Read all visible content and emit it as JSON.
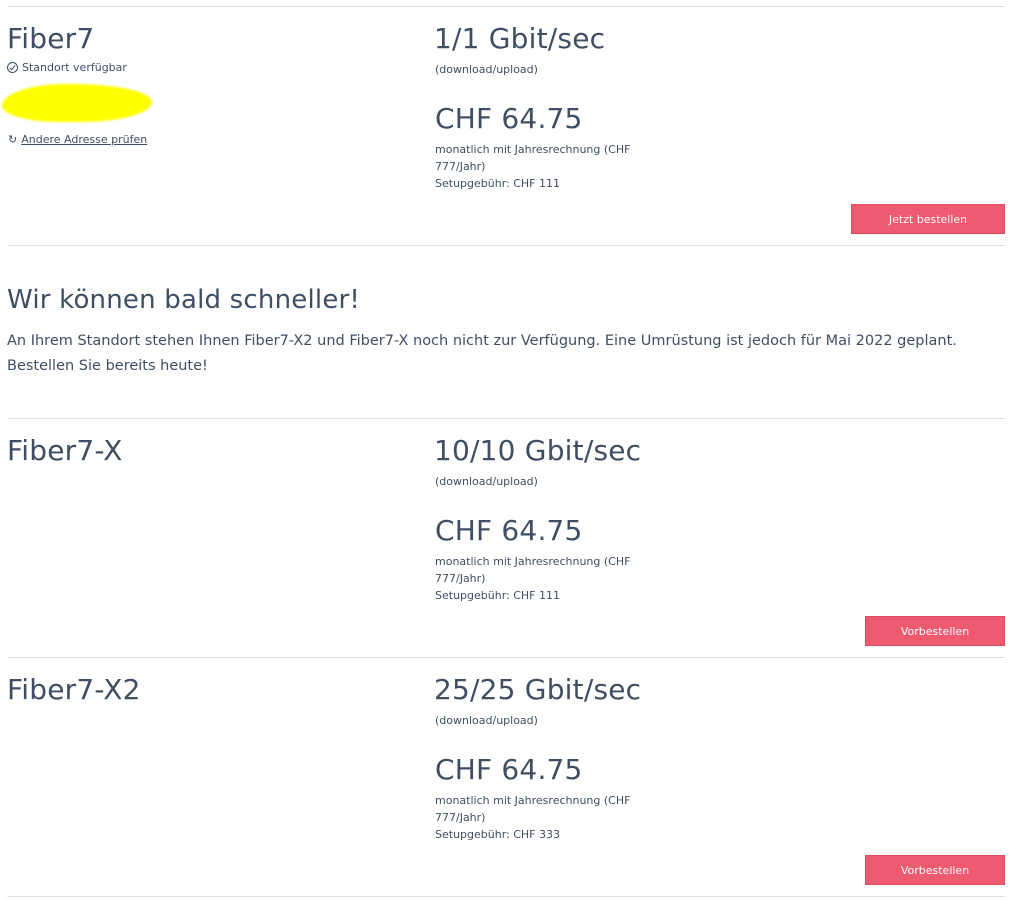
{
  "offers": [
    {
      "name": "Fiber7",
      "speed": "1/1 Gbit/sec",
      "direction": "(download/upload)",
      "price": "CHF 64.75",
      "billing_line1": "monatlich mit Jahresrechnung (CHF",
      "billing_line2": "777/Jahr)",
      "setup": "Setupgebühr: CHF 111",
      "button": "Jetzt bestellen"
    },
    {
      "name": "Fiber7-X",
      "speed": "10/10 Gbit/sec",
      "direction": "(download/upload)",
      "price": "CHF 64.75",
      "billing_line1": "monatlich mit Jahresrechnung (CHF",
      "billing_line2": "777/Jahr)",
      "setup": "Setupgebühr: CHF 111",
      "button": "Vorbestellen"
    },
    {
      "name": "Fiber7-X2",
      "speed": "25/25 Gbit/sec",
      "direction": "(download/upload)",
      "price": "CHF 64.75",
      "billing_line1": "monatlich mit Jahresrechnung (CHF",
      "billing_line2": "777/Jahr)",
      "setup": "Setupgebühr: CHF 333",
      "button": "Vorbestellen"
    }
  ],
  "availability": {
    "status": "Standort verfügbar",
    "status_icon": "check-circle-icon",
    "recheck_label": "Andere Adresse prüfen",
    "recheck_icon": "refresh-icon",
    "redaction_color": "#ffff00"
  },
  "upgrade": {
    "title": "Wir können bald schneller!",
    "text": "An Ihrem Standort stehen Ihnen Fiber7-X2 und Fiber7-X noch nicht zur Verfügung. Eine Umrüstung ist jedoch für Mai 2022 geplant. Bestellen Sie bereits heute!"
  },
  "colors": {
    "accent": "#ee5a6f",
    "text": "#3f4e63",
    "divider": "#dcdfe3"
  }
}
